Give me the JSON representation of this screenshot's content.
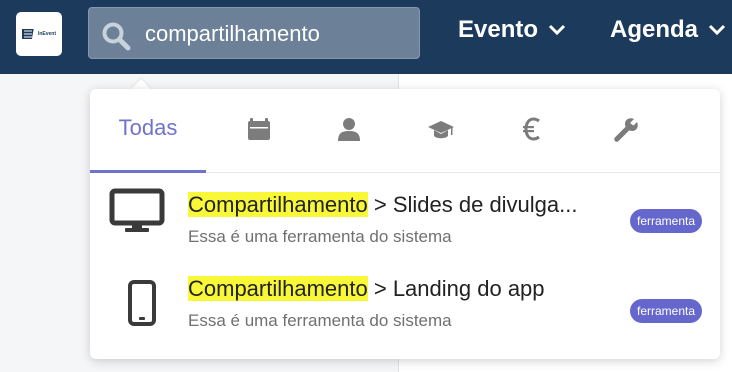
{
  "header": {
    "logo_text": "InEvent",
    "search": {
      "value": "compartilhamento",
      "placeholder": ""
    },
    "menus": [
      {
        "label": "Evento"
      },
      {
        "label": "Agenda"
      }
    ]
  },
  "dropdown": {
    "tabs": [
      {
        "label": "Todas",
        "icon": "text",
        "active": true
      },
      {
        "label": "",
        "icon": "calendar-icon"
      },
      {
        "label": "",
        "icon": "person-icon"
      },
      {
        "label": "",
        "icon": "graduation-cap-icon"
      },
      {
        "label": "",
        "icon": "euro-icon"
      },
      {
        "label": "",
        "icon": "wrench-icon"
      }
    ],
    "results": [
      {
        "icon": "desktop-icon",
        "highlight": "Compartilhamento",
        "title_rest": " > Slides de divulga...",
        "subtitle": "Essa é uma ferramenta do sistema",
        "badge": "ferramenta"
      },
      {
        "icon": "mobile-icon",
        "highlight": "Compartilhamento",
        "title_rest": " > Landing do app",
        "subtitle": "Essa é uma ferramenta do sistema",
        "badge": "ferramenta"
      }
    ]
  },
  "colors": {
    "topbar": "#1c3a5c",
    "accent": "#6f73c9",
    "badge": "#6667cc",
    "highlight": "#f8f838"
  }
}
